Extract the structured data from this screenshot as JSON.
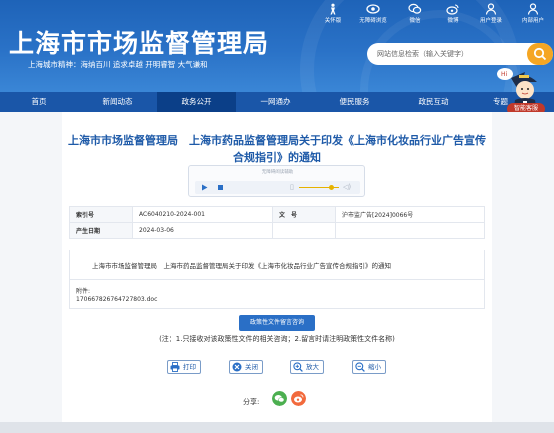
{
  "header": {
    "title": "上海市市场监督管理局",
    "slogan": "上海城市精神：海纳百川   追求卓越   开明睿智   大气谦和",
    "top_links": [
      {
        "label": "关怀版",
        "icon": "elder-care-icon"
      },
      {
        "label": "无障碍浏览",
        "icon": "eye-icon"
      },
      {
        "label": "微信",
        "icon": "wechat-icon"
      },
      {
        "label": "微博",
        "icon": "weibo-icon"
      },
      {
        "label": "用户登录",
        "icon": "user-icon"
      },
      {
        "label": "内部用户",
        "icon": "internal-user-icon"
      }
    ],
    "search_placeholder": "网站信息检索（输入关键字）",
    "assistant_label": "智能客服"
  },
  "nav": {
    "items": [
      "首页",
      "新闻动态",
      "政务公开",
      "一网通办",
      "便民服务",
      "政民互动",
      "专题"
    ],
    "active_index": 2
  },
  "article": {
    "title": "上海市市场监督管理局　上海市药品监督管理局关于印发《上海市化妆品行业广告宣传合规指引》的通知",
    "player_tip": "无障碍阅读辅助",
    "meta": {
      "index_label": "索引号",
      "index_value": "AC6040210-2024-001",
      "doc_no_label": "文　号",
      "doc_no_value": "沪市监广告[2024]0066号",
      "date_label": "产生日期",
      "date_value": "2024-03-06"
    },
    "body_text": "上海市市场监督管理局　上海市药品监督管理局关于印发《上海市化妆品行业广告宣传合规指引》的通知",
    "attachment_label": "附件:",
    "attachment_file": "1706678267647278​03.doc",
    "consult_button": "政策性文件留言咨询",
    "note": "(注：1.只接收对该政策性文件的相关咨询；2.留言时请注明政策性文件名称)",
    "actions": [
      {
        "label": "打印",
        "icon": "print-icon"
      },
      {
        "label": "关闭",
        "icon": "close-icon"
      },
      {
        "label": "放大",
        "icon": "zoom-in-icon"
      },
      {
        "label": "缩小",
        "icon": "zoom-out-icon"
      }
    ],
    "share_label": "分享:"
  },
  "colors": {
    "brand_blue": "#1e63b8",
    "nav_blue": "#1a56a8",
    "title_blue": "#1e5aa8",
    "search_orange": "#f5a623"
  }
}
